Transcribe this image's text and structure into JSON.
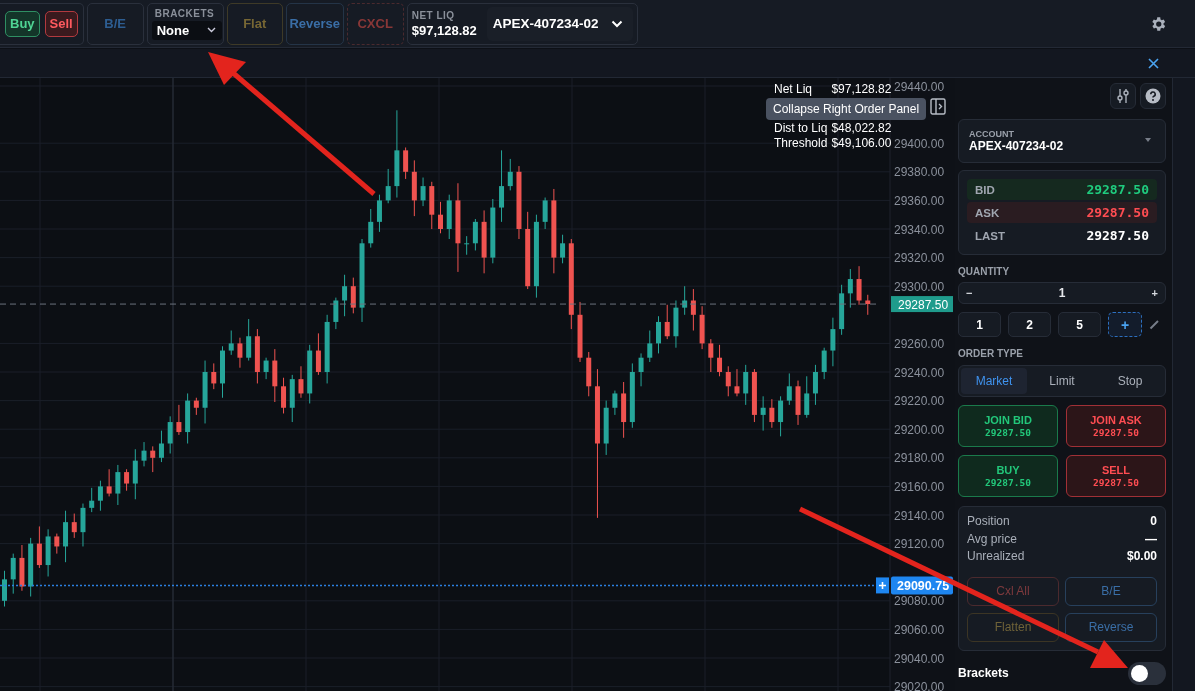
{
  "toolbar": {
    "buy": "Buy",
    "sell": "Sell",
    "breakeven": "B/E",
    "brackets": {
      "label": "BRACKETS",
      "value": "None"
    },
    "flat": "Flat",
    "reverse": "Reverse",
    "cancel": "CXCL",
    "net_liq": {
      "label": "NET LIQ",
      "value": "$97,128.82"
    },
    "account": "APEX-407234-02"
  },
  "chart": {
    "stats": [
      {
        "label": "Net Liq",
        "value": "$97,128.82"
      },
      {
        "label": "Dist to Liq",
        "value": "$48,022.82"
      },
      {
        "label": "Threshold",
        "value": "$49,106.00"
      }
    ],
    "tooltip": "Collapse Right Order Panel",
    "chart_data": {
      "type": "candlestick",
      "ylim": [
        29020,
        29440
      ],
      "grid": true,
      "ref_lines": [
        {
          "axis": "y",
          "value": 29287.5,
          "label": "29287.50",
          "color": "#6b717c"
        },
        {
          "axis": "y",
          "value": 29090.75,
          "label": "29090.75",
          "color": "#2b7fe0"
        }
      ],
      "yticks": [
        {
          "value": 29440,
          "label": "29440.00"
        },
        {
          "value": 29400,
          "label": "29400.00"
        },
        {
          "value": 29380,
          "label": "29380.00"
        },
        {
          "value": 29360,
          "label": "29360.00"
        },
        {
          "value": 29340,
          "label": "29340.00"
        },
        {
          "value": 29320,
          "label": "29320.00"
        },
        {
          "value": 29300,
          "label": "29300.00"
        },
        {
          "value": 29260,
          "label": "29260.00"
        },
        {
          "value": 29240,
          "label": "29240.00"
        },
        {
          "value": 29220,
          "label": "29220.00"
        },
        {
          "value": 29200,
          "label": "29200.00"
        },
        {
          "value": 29180,
          "label": "29180.00"
        },
        {
          "value": 29160,
          "label": "29160.00"
        },
        {
          "value": 29140,
          "label": "29140.00"
        },
        {
          "value": 29120,
          "label": "29120.00"
        },
        {
          "value": 29080,
          "label": "29080.00"
        },
        {
          "value": 29060,
          "label": "29060.00"
        },
        {
          "value": 29040,
          "label": "29040.00"
        },
        {
          "value": 29020,
          "label": "29020.00"
        }
      ],
      "ohlc": [
        [
          29080,
          29101,
          29076,
          29095
        ],
        [
          29095,
          29113,
          29085,
          29110
        ],
        [
          29110,
          29119,
          29087,
          29090
        ],
        [
          29090,
          29124,
          29083,
          29120
        ],
        [
          29120,
          29132,
          29103,
          29105
        ],
        [
          29105,
          29130,
          29097,
          29125
        ],
        [
          29125,
          29127,
          29113,
          29118
        ],
        [
          29118,
          29143,
          29107,
          29135
        ],
        [
          29135,
          29141,
          29124,
          29128
        ],
        [
          29128,
          29148,
          29118,
          29145
        ],
        [
          29145,
          29159,
          29142,
          29150
        ],
        [
          29150,
          29164,
          29143,
          29160
        ],
        [
          29160,
          29172,
          29153,
          29155
        ],
        [
          29155,
          29175,
          29147,
          29170
        ],
        [
          29170,
          29172,
          29157,
          29162
        ],
        [
          29162,
          29186,
          29151,
          29178
        ],
        [
          29178,
          29191,
          29174,
          29185
        ],
        [
          29185,
          29188,
          29170,
          29180
        ],
        [
          29180,
          29199,
          29177,
          29190
        ],
        [
          29190,
          29209,
          29183,
          29205
        ],
        [
          29205,
          29217,
          29196,
          29198
        ],
        [
          29198,
          29225,
          29190,
          29220
        ],
        [
          29220,
          29222,
          29210,
          29215
        ],
        [
          29215,
          29248,
          29204,
          29240
        ],
        [
          29240,
          29246,
          29228,
          29232
        ],
        [
          29232,
          29258,
          29222,
          29255
        ],
        [
          29255,
          29269,
          29252,
          29260
        ],
        [
          29260,
          29264,
          29243,
          29250
        ],
        [
          29250,
          29277,
          29248,
          29265
        ],
        [
          29265,
          29270,
          29232,
          29240
        ],
        [
          29240,
          29250,
          29235,
          29248
        ],
        [
          29248,
          29256,
          29219,
          29230
        ],
        [
          29230,
          29236,
          29211,
          29215
        ],
        [
          29215,
          29238,
          29205,
          29235
        ],
        [
          29235,
          29244,
          29222,
          29225
        ],
        [
          29225,
          29259,
          29218,
          29255
        ],
        [
          29255,
          29267,
          29238,
          29240
        ],
        [
          29240,
          29280,
          29232,
          29275
        ],
        [
          29275,
          29292,
          29270,
          29290
        ],
        [
          29290,
          29308,
          29279,
          29300
        ],
        [
          29300,
          29306,
          29281,
          29285
        ],
        [
          29285,
          29333,
          29275,
          29330
        ],
        [
          29330,
          29354,
          29327,
          29345
        ],
        [
          29345,
          29364,
          29338,
          29360
        ],
        [
          29360,
          29382,
          29358,
          29370
        ],
        [
          29370,
          29423,
          29362,
          29395
        ],
        [
          29395,
          29397,
          29375,
          29380
        ],
        [
          29380,
          29388,
          29349,
          29360
        ],
        [
          29360,
          29376,
          29356,
          29370
        ],
        [
          29370,
          29373,
          29340,
          29350
        ],
        [
          29350,
          29359,
          29337,
          29340
        ],
        [
          29340,
          29364,
          29333,
          29360
        ],
        [
          29360,
          29372,
          29310,
          29330
        ],
        [
          29330,
          29335,
          29322,
          29330
        ],
        [
          29330,
          29347,
          29325,
          29345
        ],
        [
          29345,
          29353,
          29309,
          29320
        ],
        [
          29320,
          29361,
          29316,
          29355
        ],
        [
          29355,
          29395,
          29345,
          29370
        ],
        [
          29370,
          29389,
          29367,
          29380
        ],
        [
          29380,
          29384,
          29333,
          29340
        ],
        [
          29340,
          29352,
          29298,
          29300
        ],
        [
          29300,
          29350,
          29292,
          29345
        ],
        [
          29345,
          29362,
          29340,
          29360
        ],
        [
          29360,
          29368,
          29309,
          29320
        ],
        [
          29320,
          29336,
          29316,
          29330
        ],
        [
          29330,
          29333,
          29270,
          29280
        ],
        [
          29280,
          29289,
          29247,
          29250
        ],
        [
          29250,
          29254,
          29223,
          29230
        ],
        [
          29230,
          29242,
          29138,
          29190
        ],
        [
          29190,
          29220,
          29182,
          29215
        ],
        [
          29215,
          29227,
          29210,
          29225
        ],
        [
          29225,
          29233,
          29194,
          29205
        ],
        [
          29205,
          29246,
          29201,
          29240
        ],
        [
          29240,
          29253,
          29230,
          29250
        ],
        [
          29250,
          29269,
          29247,
          29260
        ],
        [
          29260,
          29279,
          29253,
          29275
        ],
        [
          29275,
          29287,
          29263,
          29265
        ],
        [
          29265,
          29290,
          29257,
          29285
        ],
        [
          29285,
          29300,
          29280,
          29290
        ],
        [
          29290,
          29298,
          29269,
          29280
        ],
        [
          29280,
          29286,
          29256,
          29260
        ],
        [
          29260,
          29263,
          29240,
          29250
        ],
        [
          29250,
          29259,
          29237,
          29240
        ],
        [
          29240,
          29244,
          29223,
          29230
        ],
        [
          29230,
          29242,
          29223,
          29225
        ],
        [
          29225,
          29245,
          29217,
          29240
        ],
        [
          29240,
          29242,
          29205,
          29210
        ],
        [
          29210,
          29223,
          29199,
          29215
        ],
        [
          29215,
          29221,
          29201,
          29205
        ],
        [
          29205,
          29223,
          29195,
          29220
        ],
        [
          29220,
          29239,
          29217,
          29230
        ],
        [
          29230,
          29234,
          29203,
          29210
        ],
        [
          29210,
          29237,
          29208,
          29225
        ],
        [
          29225,
          29245,
          29217,
          29240
        ],
        [
          29240,
          29257,
          29235,
          29255
        ],
        [
          29255,
          29278,
          29244,
          29270
        ],
        [
          29270,
          29301,
          29266,
          29295
        ],
        [
          29295,
          29312,
          29285,
          29305
        ],
        [
          29305,
          29314,
          29287,
          29290
        ],
        [
          29290,
          29294,
          29280,
          29287.5
        ]
      ]
    }
  },
  "panel": {
    "account": {
      "label": "ACCOUNT",
      "value": "APEX-407234-02"
    },
    "quotes": [
      {
        "kind": "bid",
        "label": "BID",
        "value": "29287.50"
      },
      {
        "kind": "ask",
        "label": "ASK",
        "value": "29287.50"
      },
      {
        "kind": "last",
        "label": "LAST",
        "value": "29287.50"
      }
    ],
    "quantity": {
      "label": "QUANTITY",
      "minus": "−",
      "value": "1",
      "plus": "+",
      "presets": [
        "1",
        "2",
        "5"
      ],
      "add": "+"
    },
    "order_type": {
      "label": "ORDER TYPE",
      "types": [
        {
          "label": "Market",
          "selected": true
        },
        {
          "label": "Limit",
          "selected": false
        },
        {
          "label": "Stop",
          "selected": false
        }
      ]
    },
    "actions": [
      {
        "kind": "buy",
        "label": "JOIN BID",
        "price": "29287.50"
      },
      {
        "kind": "sell",
        "label": "JOIN ASK",
        "price": "29287.50"
      },
      {
        "kind": "buy",
        "label": "BUY",
        "price": "29287.50"
      },
      {
        "kind": "sell",
        "label": "SELL",
        "price": "29287.50"
      }
    ],
    "position": [
      {
        "label": "Position",
        "value": "0"
      },
      {
        "label": "Avg price",
        "value": "—"
      },
      {
        "label": "Unrealized",
        "value": "$0.00"
      }
    ],
    "position_buttons": [
      {
        "kind": "cancel",
        "label": "Cxl All"
      },
      {
        "kind": "breakeven",
        "label": "B/E"
      },
      {
        "kind": "flatten",
        "label": "Flatten"
      },
      {
        "kind": "reverse",
        "label": "Reverse"
      }
    ],
    "brackets": {
      "label": "Brackets",
      "on": false
    }
  }
}
